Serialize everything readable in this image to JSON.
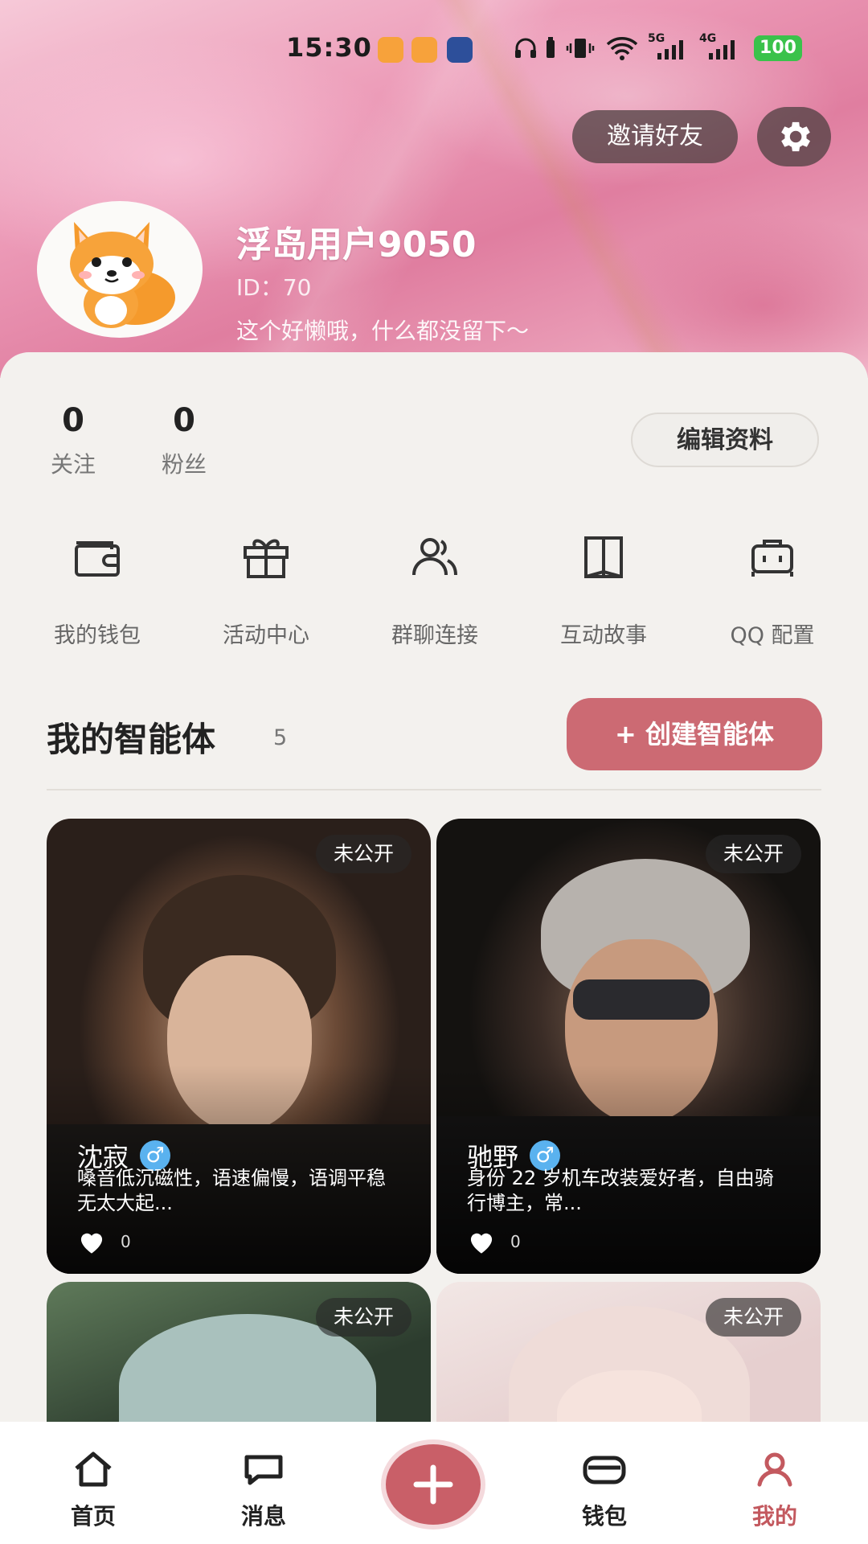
{
  "status_bar": {
    "time": "15:30",
    "battery": "100",
    "net1": "5G",
    "net2": "4G"
  },
  "header": {
    "invite_label": "邀请好友",
    "username": "浮岛用户9050",
    "user_id": "ID：70",
    "bio": "这个好懒哦，什么都没留下～"
  },
  "stats": [
    {
      "value": "0",
      "label": "关注"
    },
    {
      "value": "0",
      "label": "粉丝"
    }
  ],
  "edit_profile_label": "编辑资料",
  "tools": [
    {
      "label": "我的钱包",
      "icon": "wallet-icon"
    },
    {
      "label": "活动中心",
      "icon": "gift-icon"
    },
    {
      "label": "群聊连接",
      "icon": "group-icon"
    },
    {
      "label": "互动故事",
      "icon": "book-icon"
    },
    {
      "label": "QQ 配置",
      "icon": "robot-icon"
    }
  ],
  "agents_section": {
    "title": "我的智能体",
    "count": "5",
    "create_label": "+ 创建智能体"
  },
  "agents": [
    {
      "badge": "未公开",
      "name": "沈寂",
      "gender": "♂",
      "desc": "嗓音低沉磁性，语速偏慢，语调平稳无太大起...",
      "likes": "0"
    },
    {
      "badge": "未公开",
      "name": "驰野",
      "gender": "♂",
      "desc": "身份 22 岁机车改装爱好者，自由骑行博主，常...",
      "likes": "0"
    },
    {
      "badge": "未公开"
    },
    {
      "badge": "未公开"
    }
  ],
  "nav": [
    {
      "label": "首页",
      "icon": "home-icon"
    },
    {
      "label": "消息",
      "icon": "chat-icon"
    },
    {
      "label": "钱包",
      "icon": "wallet-icon"
    },
    {
      "label": "我的",
      "icon": "profile-icon",
      "active": true
    }
  ],
  "colors": {
    "accent": "#cc6a73",
    "active_nav": "#c3595f",
    "battery": "#3ac24b"
  }
}
